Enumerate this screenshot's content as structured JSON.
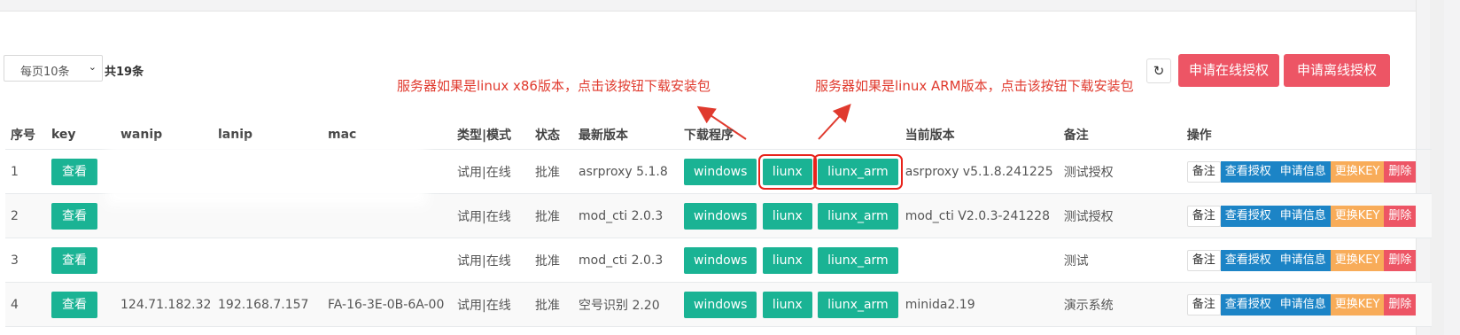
{
  "toolbar": {
    "page_size": "每页10条",
    "total": "共19条",
    "apply_online": "申请在线授权",
    "apply_offline": "申请离线授权",
    "refresh_icon": "refresh-icon"
  },
  "annotations": {
    "x86": "服务器如果是linux x86版本，点击该按钮下载安装包",
    "arm": "服务器如果是linux ARM版本，点击该按钮下载安装包"
  },
  "table": {
    "headers": [
      "序号",
      "key",
      "wanip",
      "lanip",
      "mac",
      "类型|模式",
      "状态",
      "最新版本",
      "下载程序",
      "当前版本",
      "备注",
      "操作"
    ],
    "view_label": "查看",
    "download": {
      "windows": "windows",
      "linux": "liunx",
      "arm": "liunx_arm"
    },
    "ops": {
      "note": "备注",
      "view_auth": "查看授权",
      "apply_info": "申请信息",
      "change_key": "更换KEY",
      "delete": "删除"
    },
    "rows": [
      {
        "no": "1",
        "wanip": "",
        "lanip": "",
        "mac": "",
        "type": "试用|在线",
        "status": "批准",
        "latest": "asrproxy 5.1.8",
        "current": "asrproxy v5.1.8.241225",
        "remark": "测试授权"
      },
      {
        "no": "2",
        "wanip": "",
        "lanip": "",
        "mac": "",
        "type": "试用|在线",
        "status": "批准",
        "latest": "mod_cti 2.0.3",
        "current": "mod_cti V2.0.3-241228",
        "remark": "测试授权"
      },
      {
        "no": "3",
        "wanip": "",
        "lanip": "",
        "mac": "",
        "type": "试用|在线",
        "status": "批准",
        "latest": "mod_cti 2.0.3",
        "current": "",
        "remark": "测试"
      },
      {
        "no": "4",
        "wanip": "124.71.182.32",
        "lanip": "192.168.7.157",
        "mac": "FA-16-3E-0B-6A-00",
        "type": "试用|在线",
        "status": "批准",
        "latest": "空号识别 2.20",
        "current": "minida2.19",
        "remark": "演示系统"
      }
    ]
  }
}
